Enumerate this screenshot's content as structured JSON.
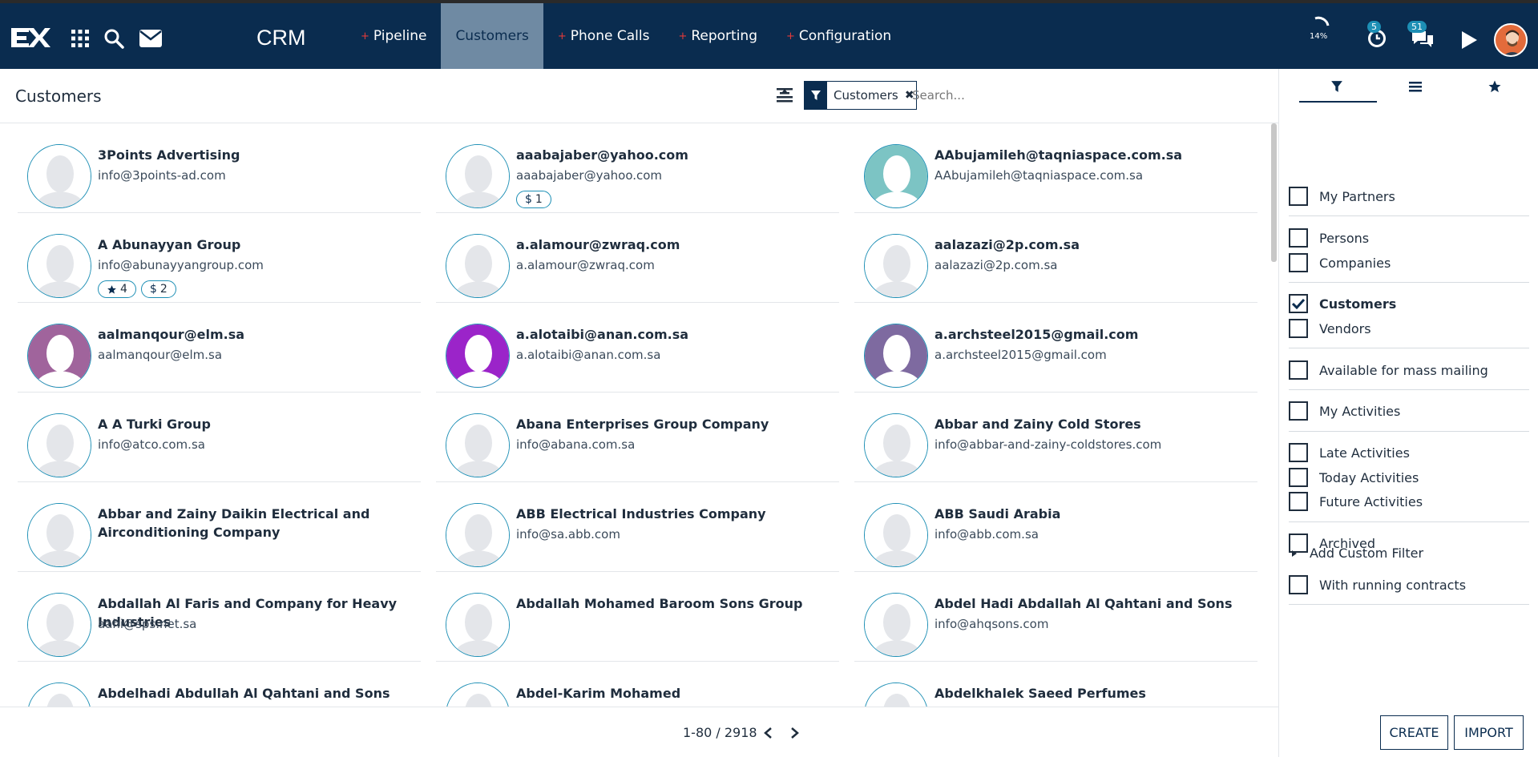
{
  "app": {
    "name": "CRM"
  },
  "topbar": {
    "nav": [
      {
        "label": "Pipeline",
        "plus": true,
        "active": false
      },
      {
        "label": "Customers",
        "plus": false,
        "active": true
      },
      {
        "label": "Phone Calls",
        "plus": true,
        "active": false
      },
      {
        "label": "Reporting",
        "plus": true,
        "active": false
      },
      {
        "label": "Configuration",
        "plus": true,
        "active": false
      }
    ],
    "progress_label": "14%",
    "activities_count": "5",
    "messages_count": "51"
  },
  "control": {
    "title": "Customers",
    "facet_label": "Customers",
    "search_placeholder": "Search..."
  },
  "records": [
    {
      "name": "3Points Advertising",
      "email": "info@3points-ad.com",
      "avatar": "#ffffff",
      "tags": []
    },
    {
      "name": "aaabajaber@yahoo.com",
      "email": "aaabajaber@yahoo.com",
      "avatar": "#ffffff",
      "tags": [
        {
          "icon": "dollar",
          "text": "1"
        }
      ]
    },
    {
      "name": "AAbujamileh@taqniaspace.com.sa",
      "email": "AAbujamileh@taqniaspace.com.sa",
      "avatar": "#7cc4c4",
      "tags": []
    },
    {
      "name": "A Abunayyan Group",
      "email": "info@abunayyangroup.com",
      "avatar": "#ffffff",
      "tags": [
        {
          "icon": "star",
          "text": "4"
        },
        {
          "icon": "dollar",
          "text": "2"
        }
      ]
    },
    {
      "name": "a.alamour@zwraq.com",
      "email": "a.alamour@zwraq.com",
      "avatar": "#ffffff",
      "tags": []
    },
    {
      "name": "aalazazi@2p.com.sa",
      "email": "aalazazi@2p.com.sa",
      "avatar": "#ffffff",
      "tags": []
    },
    {
      "name": "aalmanqour@elm.sa",
      "email": "aalmanqour@elm.sa",
      "avatar": "#a0649c",
      "tags": []
    },
    {
      "name": "a.alotaibi@anan.com.sa",
      "email": "a.alotaibi@anan.com.sa",
      "avatar": "#9b24c9",
      "tags": []
    },
    {
      "name": "a.archsteel2015@gmail.com",
      "email": "a.archsteel2015@gmail.com",
      "avatar": "#7e6aa0",
      "tags": []
    },
    {
      "name": "A A Turki Group",
      "email": "info@atco.com.sa",
      "avatar": "#ffffff",
      "tags": []
    },
    {
      "name": "Abana Enterprises Group Company",
      "email": "info@abana.com.sa",
      "avatar": "#ffffff",
      "tags": []
    },
    {
      "name": "Abbar and Zainy Cold Stores",
      "email": "info@abbar-and-zainy-coldstores.com",
      "avatar": "#ffffff",
      "tags": []
    },
    {
      "name": "Abbar and Zainy Daikin Electrical and Airconditioning Company",
      "email": "",
      "avatar": "#ffffff",
      "tags": []
    },
    {
      "name": "ABB Electrical Industries Company",
      "email": "info@sa.abb.com",
      "avatar": "#ffffff",
      "tags": []
    },
    {
      "name": "ABB Saudi Arabia",
      "email": "info@abb.com.sa",
      "avatar": "#ffffff",
      "tags": []
    },
    {
      "name": "Abdallah Al Faris and Company for Heavy Industries",
      "email": "aahi@sps.net.sa",
      "avatar": "#ffffff",
      "tags": []
    },
    {
      "name": "Abdallah Mohamed Baroom Sons Group",
      "email": "",
      "avatar": "#ffffff",
      "tags": []
    },
    {
      "name": "Abdel Hadi Abdallah Al Qahtani and Sons",
      "email": "info@ahqsons.com",
      "avatar": "#ffffff",
      "tags": []
    },
    {
      "name": "Abdelhadi Abdullah Al Qahtani and Sons Beverage Industry",
      "email": "",
      "avatar": "#ffffff",
      "tags": []
    },
    {
      "name": "Abdel-Karim Mohamed",
      "email": "",
      "avatar": "#ffffff",
      "tags": []
    },
    {
      "name": "Abdelkhalek Saeed Perfumes",
      "email": "",
      "avatar": "#ffffff",
      "tags": []
    }
  ],
  "pager": {
    "text": "1-80 / 2918"
  },
  "filters": [
    {
      "label": "My Partners",
      "checked": false
    },
    {
      "label": "Persons",
      "checked": false
    },
    {
      "label": "Companies",
      "checked": false
    },
    {
      "label": "Customers",
      "checked": true
    },
    {
      "label": "Vendors",
      "checked": false
    },
    {
      "label": "Available for mass mailing",
      "checked": false
    },
    {
      "label": "My Activities",
      "checked": false
    },
    {
      "label": "Late Activities",
      "checked": false
    },
    {
      "label": "Today Activities",
      "checked": false
    },
    {
      "label": "Future Activities",
      "checked": false
    },
    {
      "label": "Archived",
      "checked": false
    },
    {
      "label": "With running contracts",
      "checked": false
    }
  ],
  "add_custom_filter": "Add Custom Filter",
  "buttons": {
    "create": "CREATE",
    "import": "IMPORT"
  },
  "colors": {
    "primary": "#0a2c4f",
    "accent": "#1d8fb5",
    "active_nav": "#6f8aa3",
    "plus": "#e23a3a"
  }
}
